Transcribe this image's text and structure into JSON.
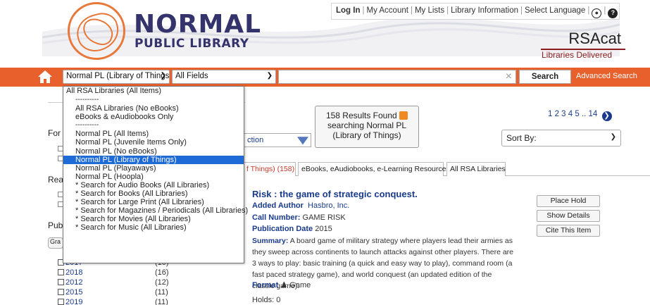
{
  "header": {
    "logo_title": "NORMAL",
    "logo_subtitle": "PUBLIC LIBRARY",
    "top_links": [
      "Log In",
      "My Account",
      "My Lists",
      "Library Information",
      "Select Language"
    ],
    "rsacat_title": "RSAcat",
    "rsacat_tagline": "Libraries Delivered"
  },
  "search": {
    "library_selected": "Normal PL (Library of Things)",
    "fields_selected": "All Fields",
    "query": "",
    "clear_glyph": "×",
    "search_label": "Search",
    "advanced_label": "Advanced Search"
  },
  "dropdown": {
    "options": [
      "All RSA Libraries (All Items)",
      "----------",
      "All RSA Libraries (No eBooks)",
      "eBooks & eAudiobooks Only",
      "----------",
      "Normal PL (All Items)",
      "Normal PL (Juvenile Items Only)",
      "Normal PL (No eBooks)",
      "Normal PL (Library of Things)",
      "Normal PL (Playaways)",
      "Normal PL (Hoopla)",
      "* Search for Audio Books (All Libraries)",
      "* Search for Books (All Libraries)",
      "* Search for Large Print (All Libraries)",
      "* Search for Magazines / Periodicals (All Libraries)",
      "* Search for Movies (All Libraries)",
      "* Search for Music (All Libraries)"
    ],
    "selected_index": 8
  },
  "facets": {
    "labels": [
      "For",
      "Rea",
      "Pub"
    ],
    "grab_label": "Gra",
    "years": [
      {
        "year": "2017",
        "count": "(10)"
      },
      {
        "year": "2018",
        "count": "(16)"
      },
      {
        "year": "2012",
        "count": "(12)"
      },
      {
        "year": "2015",
        "count": "(11)"
      },
      {
        "year": "2019",
        "count": "(11)"
      }
    ]
  },
  "results": {
    "summary_line1": "158 Results Found",
    "summary_line2": "searching Normal PL",
    "summary_line3": "(Library of Things)",
    "section_label": "ction",
    "pages": "1 2 3 4 5 .. 14",
    "next_glyph": "❯",
    "sort_by_label": "Sort By:",
    "tabs": [
      "f Things) (158)",
      "eBooks, eAudiobooks, e-Learning Resources",
      "All RSA Libraries"
    ]
  },
  "record": {
    "title": "Risk : the game of strategic conquest.",
    "added_author_key": "Added Author",
    "added_author": "Hasbro, Inc.",
    "call_number_key": "Call Number:",
    "call_number": "GAME RISK",
    "pub_date_key": "Publication Date",
    "pub_date": "2015",
    "summary_key": "Summary:",
    "summary": "A board game of military strategy where players lead their armies as they sweep across continents to launch attacks against other players. There are 3 ways to play: basic training (a quick and easy way to play), command room (a fast paced strategy game), and world conquest (an updated edition of the classic game).",
    "format_key": "Format",
    "format": "Game",
    "holds": "Holds: 0",
    "buttons": [
      "Place Hold",
      "Show Details",
      "Cite This Item"
    ]
  },
  "colors": {
    "orange_bar": "#e8612c",
    "navy": "#34336b",
    "link_blue": "#1a3b8c",
    "rsacat_red": "#8a1d20",
    "selection_blue": "#1e6ad6"
  }
}
